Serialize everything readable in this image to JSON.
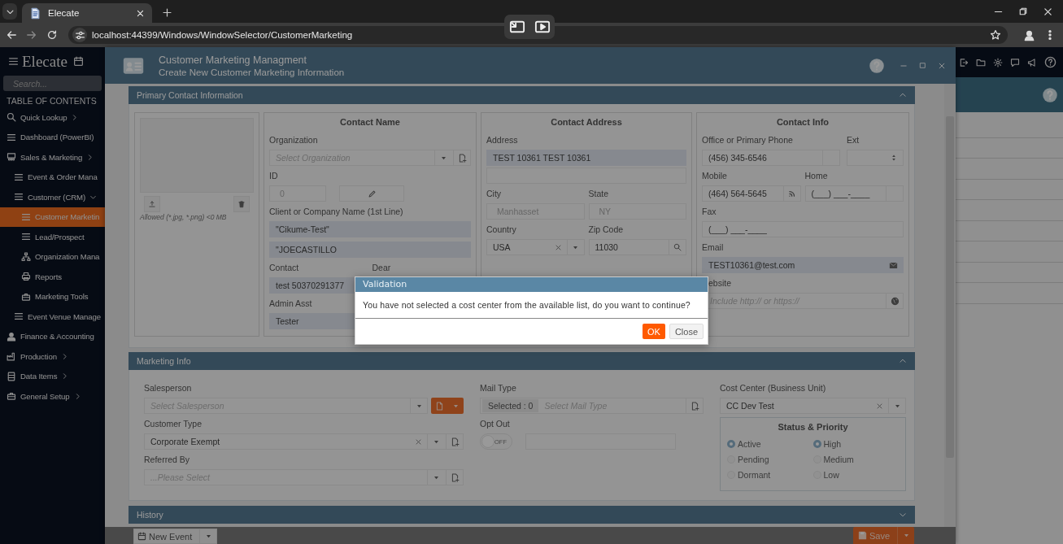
{
  "browser": {
    "tab_title": "Elecate",
    "url": "localhost:44399/Windows/WindowSelector/CustomerMarketing"
  },
  "app": {
    "logo": "Elecate",
    "search_placeholder": "Search...",
    "toc_heading": "TABLE OF CONTENTS"
  },
  "sidebar": [
    {
      "label": "Quick Lookup",
      "expanded": false,
      "selected": false
    },
    {
      "label": "Dashboard (PowerBI)",
      "selected": false
    },
    {
      "label": "Sales & Marketing",
      "expanded": false,
      "selected": false,
      "children": [
        {
          "label": "Event & Order Mana",
          "selected": false
        },
        {
          "label": "Customer (CRM)",
          "expanded": true,
          "selected": false,
          "children": [
            {
              "label": "Customer Marketin",
              "selected": true
            },
            {
              "label": "Lead/Prospect",
              "selected": false
            },
            {
              "label": "Organization Mana",
              "selected": false
            },
            {
              "label": "Reports",
              "selected": false
            },
            {
              "label": "Marketing Tools",
              "selected": false
            }
          ]
        },
        {
          "label": "Event Venue Manage",
          "selected": false
        }
      ]
    },
    {
      "label": "Finance & Accounting",
      "selected": false
    },
    {
      "label": "Production",
      "expanded": false,
      "selected": false
    },
    {
      "label": "Data Items",
      "expanded": false,
      "selected": false
    },
    {
      "label": "General Setup",
      "expanded": false,
      "selected": false
    }
  ],
  "modal": {
    "title": "Customer Marketing Managment",
    "subtitle": "Create New Customer Marketing Information"
  },
  "primary_contact": {
    "title": "Primary Contact Information",
    "expanded": true,
    "photo": {
      "note": "Allowed (*.jpg, *.png) <0 MB"
    },
    "contact_name": {
      "heading": "Contact Name",
      "organization_label": "Organization",
      "organization_placeholder": "Select Organization",
      "id_label": "ID",
      "id_value": "0",
      "company_label": "Client or Company Name (1st Line)",
      "company_line_1": "\"Cikume-Test\"",
      "company_line_2": "\"JOECASTILLO",
      "contact_label": "Contact",
      "contact_value": "test 50370291377",
      "dear_label": "Dear",
      "admin_label": "Admin Asst",
      "admin_value": "Tester"
    },
    "contact_address": {
      "heading": "Contact Address",
      "address_label": "Address",
      "address_line_1": "TEST 10361 TEST 10361",
      "city_label": "City",
      "city_value": "Manhasset",
      "state_label": "State",
      "state_value": "NY",
      "country_label": "Country",
      "country_value": "USA",
      "zip_label": "Zip Code",
      "zip_value": "11030"
    },
    "contact_info": {
      "heading": "Contact Info",
      "office_label": "Office or Primary Phone",
      "office_value": "(456) 345-6546",
      "ext_label": "Ext",
      "mobile_label": "Mobile",
      "mobile_value": "(464) 564-5645",
      "home_label": "Home",
      "home_placeholder": "(___) ___-____",
      "fax_label": "Fax",
      "fax_placeholder": "(___) ___-____",
      "email_label": "Email",
      "email_value": "TEST10361@test.com",
      "website_label": "ebsite",
      "website_placeholder": "Include http:// or https://"
    }
  },
  "marketing_info": {
    "title": "Marketing Info",
    "expanded": true,
    "salesperson_label": "Salesperson",
    "salesperson_placeholder": "Select Salesperson",
    "customer_type_label": "Customer Type",
    "customer_type_value": "Corporate Exempt",
    "referred_by_label": "Referred By",
    "referred_by_placeholder": "...Please Select",
    "mail_type_label": "Mail Type",
    "mail_type_count": "Selected : 0",
    "mail_type_placeholder": "Select Mail Type",
    "opt_out": {
      "label": "Opt Out",
      "on": false,
      "state_text": "OFF"
    },
    "cost_center_label": "Cost Center (Business Unit)",
    "cost_center_value": "CC Dev Test",
    "status_priority": {
      "heading": "Status & Priority",
      "status": [
        {
          "label": "Active",
          "selected": true
        },
        {
          "label": "Pending",
          "selected": false
        },
        {
          "label": "Dormant",
          "selected": false
        }
      ],
      "priority": [
        {
          "label": "High",
          "selected": true
        },
        {
          "label": "Medium",
          "selected": false
        },
        {
          "label": "Low",
          "selected": false
        }
      ]
    }
  },
  "history": {
    "title": "History",
    "expanded": false
  },
  "footer": {
    "new_event": "New Event",
    "save": "Save"
  },
  "dialog": {
    "title": "Validation",
    "message": "You have not selected a cost center from the available list, do you want to continue?",
    "ok": "OK",
    "close": "Close"
  }
}
